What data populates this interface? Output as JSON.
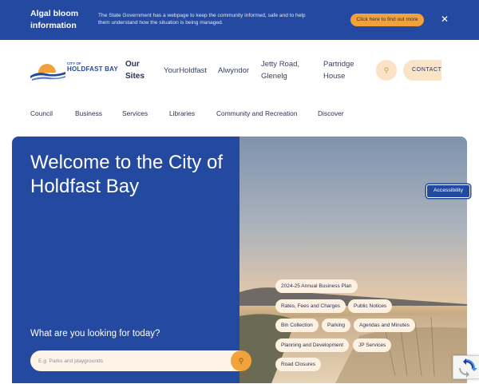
{
  "alert": {
    "title": "Algal bloom information",
    "text": "The State Government has a webpage to keep the community informed, safe and to help them understand how the situation is being managed.",
    "button_label": "Click here to find out more",
    "close_icon": "close-icon"
  },
  "header": {
    "logo_small": "CITY OF",
    "logo_text": "HOLDFAST BAY",
    "our_sites_label": "Our Sites",
    "sites": [
      "YourHoldfast",
      "Alwyndor",
      "Jetty Road, Glenelg",
      "Partridge House"
    ],
    "search_icon": "search-icon",
    "contact_label": "CONTACT"
  },
  "nav": {
    "items": [
      "Council",
      "Business",
      "Services",
      "Libraries",
      "Community and Recreation",
      "Discover"
    ]
  },
  "hero": {
    "title": "Welcome to the City of Holdfast Bay",
    "question": "What are you looking for today?",
    "search_placeholder": "E.g. Parks and playgrounds",
    "search_icon": "search-icon",
    "tags": [
      "2024-25 Annual Business Plan",
      "Rates, Fees and Charges",
      "Public Notices",
      "Bin Collection",
      "Parking",
      "Agendas and Minutes",
      "Planning and Development",
      "JP Services",
      "Road Closures"
    ]
  },
  "accessibility_label": "Accessibility",
  "colors": {
    "brand_blue": "#2449a1",
    "accent_orange": "#f2a23a",
    "cream": "#fdf1e1"
  }
}
